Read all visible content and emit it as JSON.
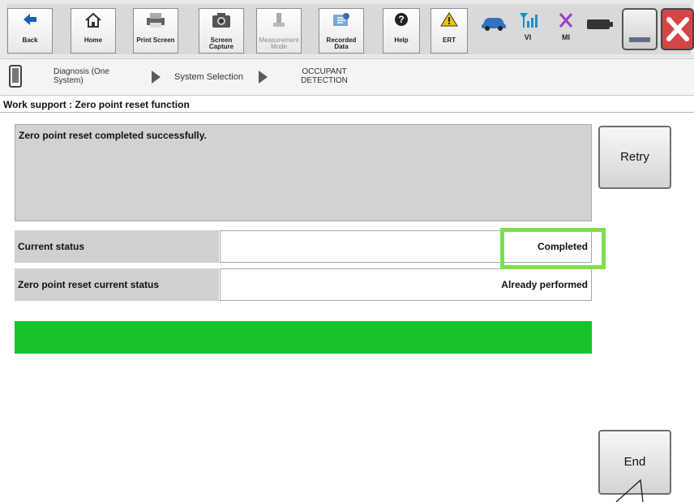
{
  "toolbar": {
    "back": "Back",
    "home": "Home",
    "print_screen": "Print Screen",
    "screen_capture": "Screen Capture",
    "measurement_mode": "Measurement Mode",
    "recorded_data": "Recorded Data",
    "help": "Help",
    "ert": "ERT",
    "vi": "VI",
    "mi": "MI"
  },
  "breadcrumb": {
    "step1": "Diagnosis (One System)",
    "step2": "System Selection",
    "step3": "OCCUPANT DETECTION"
  },
  "page_title": "Work support : Zero point reset function",
  "message": "Zero point reset completed successfully.",
  "rows": [
    {
      "label": "Current status",
      "value": "Completed"
    },
    {
      "label": "Zero point reset current status",
      "value": "Already performed"
    }
  ],
  "progress": {
    "fraction": 1.0,
    "color": "#19c22a"
  },
  "buttons": {
    "retry": "Retry",
    "end": "End"
  },
  "colors": {
    "highlight": "#7ee04b",
    "close": "#d64545"
  }
}
